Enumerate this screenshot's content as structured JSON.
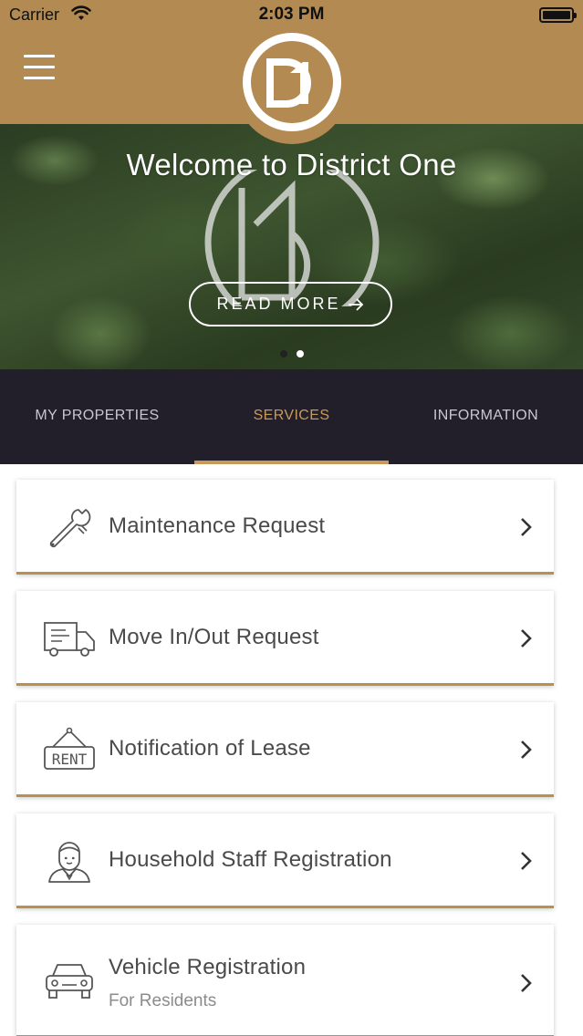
{
  "status_bar": {
    "carrier": "Carrier",
    "time": "2:03 PM"
  },
  "header": {
    "logo_text": "D1"
  },
  "hero": {
    "title": "Welcome to District One",
    "read_more_label": "READ MORE",
    "slide_count": 2,
    "active_slide": 2
  },
  "tabs": [
    {
      "label": "MY PROPERTIES",
      "active": false
    },
    {
      "label": "SERVICES",
      "active": true
    },
    {
      "label": "INFORMATION",
      "active": false
    }
  ],
  "services": [
    {
      "title": "Maintenance Request",
      "subtitle": "",
      "icon": "wrench-icon"
    },
    {
      "title": "Move In/Out Request",
      "subtitle": "",
      "icon": "truck-icon"
    },
    {
      "title": "Notification of Lease",
      "subtitle": "",
      "icon": "rent-sign-icon"
    },
    {
      "title": "Household Staff Registration",
      "subtitle": "",
      "icon": "staff-person-icon"
    },
    {
      "title": "Vehicle Registration",
      "subtitle": "For Residents",
      "icon": "car-icon"
    }
  ],
  "colors": {
    "brand_gold": "#b38a52",
    "tab_bar_bg": "#221f2a",
    "active_tab": "#c79a59"
  }
}
